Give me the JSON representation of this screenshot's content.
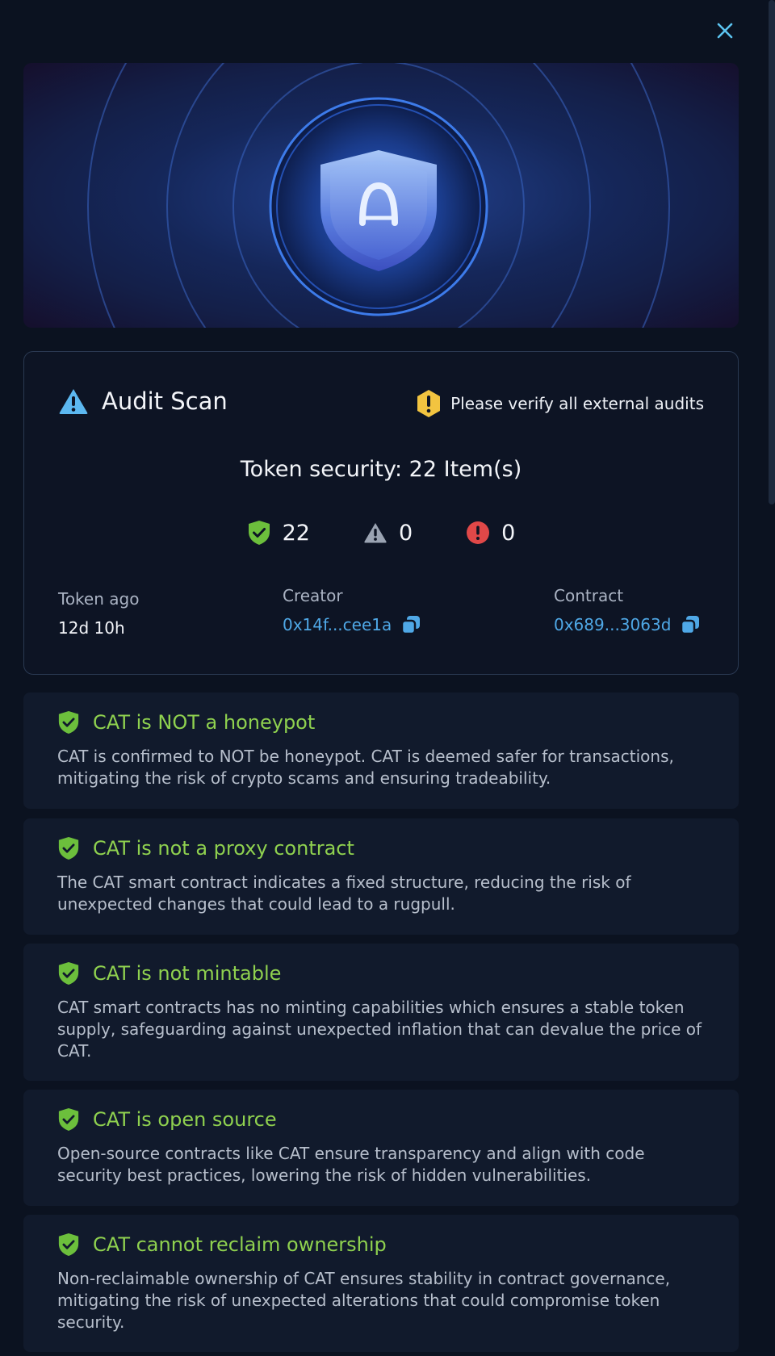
{
  "icons": {
    "close": "close-icon",
    "audit_warning": "warning-triangle-icon",
    "note_alert": "exclamation-icon",
    "safe": "shield-check-icon",
    "caution": "warning-triangle-icon",
    "danger": "exclamation-circle-icon",
    "copy": "copy-icon"
  },
  "colors": {
    "background": "#0b1220",
    "accent_blue": "#4fa8e6",
    "safe_green": "#8fd14f",
    "warning_yellow": "#f2c440",
    "danger_red": "#e04848",
    "neutral_gray": "#9aa3b2"
  },
  "audit": {
    "title": "Audit Scan",
    "note": "Please verify all external audits",
    "token_security": "Token security: 22 Item(s)",
    "counts": {
      "safe": "22",
      "caution": "0",
      "danger": "0"
    },
    "meta": {
      "token_age_label": "Token ago",
      "token_age_value": "12d 10h",
      "creator_label": "Creator",
      "creator_value": "0x14f...cee1a",
      "contract_label": "Contract",
      "contract_value": "0x689...3063d"
    }
  },
  "findings": [
    {
      "title": "CAT is NOT a honeypot",
      "description": "CAT is confirmed to NOT be honeypot. CAT is deemed safer for transactions, mitigating the risk of crypto scams and ensuring tradeability."
    },
    {
      "title": "CAT is not a proxy contract",
      "description": "The CAT smart contract indicates a fixed structure, reducing the risk of unexpected changes that could lead to a rugpull."
    },
    {
      "title": "CAT is not mintable",
      "description": "CAT smart contracts has no minting capabilities which ensures a stable token supply, safeguarding against unexpected inflation that can devalue the price of CAT."
    },
    {
      "title": "CAT is open source",
      "description": "Open-source contracts like CAT ensure transparency and align with code security best practices, lowering the risk of hidden vulnerabilities."
    },
    {
      "title": "CAT cannot reclaim ownership",
      "description": "Non-reclaimable ownership of CAT ensures stability in contract governance, mitigating the risk of unexpected alterations that could compromise token security."
    }
  ]
}
